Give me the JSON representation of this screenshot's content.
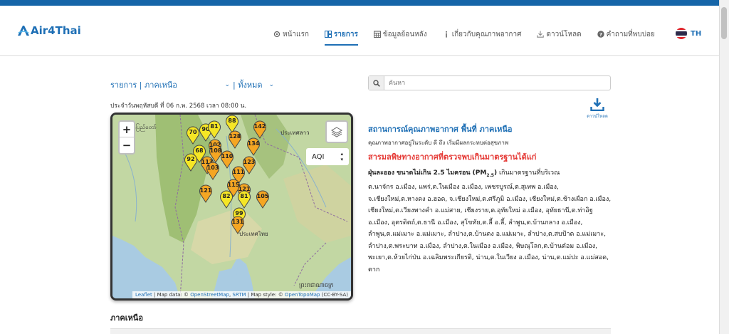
{
  "brand": {
    "name": "Air4Thai",
    "color": "#1e6fb5"
  },
  "nav": [
    {
      "label": "หน้าแรก",
      "icon": "home-icon",
      "active": false
    },
    {
      "label": "รายการ",
      "icon": "list-icon",
      "active": true
    },
    {
      "label": "ข้อมูลย้อนหลัง",
      "icon": "calendar-icon",
      "active": false
    },
    {
      "label": "เกี่ยวกับคุณภาพอากาศ",
      "icon": "info-icon",
      "active": false
    },
    {
      "label": "ดาวน์โหลด",
      "icon": "download-icon",
      "active": false
    },
    {
      "label": "คำถามที่พบบ่อย",
      "icon": "question-icon",
      "active": false
    }
  ],
  "language": {
    "code": "TH"
  },
  "filter": {
    "region": "รายการ | ภาคเหนือ",
    "scope": "| ทั้งหมด"
  },
  "date_text": "ประจำวันพฤหัสบดี ที่ 06 ก.พ. 2568 เวลา 08:00 น.",
  "map": {
    "zoom_in": "+",
    "zoom_out": "−",
    "layer_select": "AQI",
    "labels": [
      {
        "text": "နေပြည်တော်"
      },
      {
        "text": "ประเทศลาว"
      },
      {
        "text": "ประเทศไทย"
      },
      {
        "text": "ព្រះរាជាណាចក្រ"
      }
    ],
    "attribution": {
      "leaflet": "Leaflet",
      "mapdata": " | Map data: © ",
      "osm": "OpenStreetMap",
      "sep": ", ",
      "srtm": "SRTM",
      "style": " | Map style: © ",
      "otm": "OpenTopoMap",
      "license": " (CC-BY-SA)"
    },
    "markers": [
      {
        "value": "88",
        "level": "moderate"
      },
      {
        "value": "70",
        "level": "moderate"
      },
      {
        "value": "90",
        "level": "moderate"
      },
      {
        "value": "81",
        "level": "moderate"
      },
      {
        "value": "128",
        "level": "unhealthy"
      },
      {
        "value": "142",
        "level": "unhealthy"
      },
      {
        "value": "102",
        "level": "unhealthy"
      },
      {
        "value": "108",
        "level": "unhealthy"
      },
      {
        "value": "134",
        "level": "unhealthy"
      },
      {
        "value": "68",
        "level": "moderate"
      },
      {
        "value": "110",
        "level": "unhealthy"
      },
      {
        "value": "92",
        "level": "moderate"
      },
      {
        "value": "113",
        "level": "unhealthy"
      },
      {
        "value": "123",
        "level": "unhealthy"
      },
      {
        "value": "103",
        "level": "unhealthy"
      },
      {
        "value": "111",
        "level": "unhealthy"
      },
      {
        "value": "115",
        "level": "unhealthy"
      },
      {
        "value": "121",
        "level": "unhealthy"
      },
      {
        "value": "121",
        "level": "unhealthy"
      },
      {
        "value": "82",
        "level": "moderate"
      },
      {
        "value": "81",
        "level": "moderate"
      },
      {
        "value": "105",
        "level": "unhealthy"
      },
      {
        "value": "99",
        "level": "moderate"
      },
      {
        "value": "131",
        "level": "unhealthy"
      }
    ],
    "colors": {
      "moderate": "#f5e625",
      "unhealthy": "#f5a623",
      "good": "#8bd34a"
    }
  },
  "search": {
    "placeholder": "ค้นหา"
  },
  "download": {
    "label": "ดาวน์โหลด"
  },
  "info": {
    "title": "สถานการณ์คุณภาพอากาศ พื้นที่ ภาคเหนือ",
    "subtitle": "คุณภาพอากาศอยู่ในระดับ ดี ถึง เริ่มมีผลกระทบต่อสุขภาพ",
    "warning": "สารมลพิษทางอากาศที่ตรวจพบเกินมาตรฐานได้แก่",
    "pm_label_a": "ฝุ่นละออง ขนาดไม่เกิน 2.5 ไมครอน (PM",
    "pm_sub": "2.5",
    "pm_label_b": ")",
    "pm_exceed": " เกินมาตรฐานที่บริเวณ",
    "lines": [
      "ต.นาจักร อ.เมือง, แพร่,ต.ในเมือง อ.เมือง, เพชรบูรณ์,ต.สุเทพ อ.เมือง,",
      "จ.เชียงใหม่,ต.หางดง อ.ฮอด, จ.เชียงใหม่,ต.ศรีภูมิ อ.เมือง, เชียงใหม่,ต.ช้างเผือก อ.เมือง,",
      "เชียงใหม่,ต.เวียงพางคำ อ.แม่สาย, เชียงราย,ต.อุทัยใหม่ อ.เมือง, อุทัยธานี,ต.ท่าอิฐ",
      "อ.เมือง, อุตรดิตถ์,ต.ธานี อ.เมือง, สุโขทัย,ต.ลี้ อ.ลี้, ลำพูน,ต.บ้านกลาง อ.เมือง,",
      "ลำพูน,ต.แม่เมาะ อ.แม่เมาะ, ลำปาง,ต.บ้านดง อ.แม่เมาะ, ลำปาง,ต.สบป้าด อ.แม่เมาะ,",
      "ลำปาง,ต.พระบาท อ.เมือง, ลำปาง,ต.ในเมือง อ.เมือง, พิษณุโลก,ต.บ้านต๋อม อ.เมือง,",
      "พะเยา,ต.ห้วยไก่ป่น อ.เฉลิมพระเกียรติ, น่าน,ต.ในเวียง อ.เมือง, น่าน,ต.แม่ปะ อ.แม่สอด,",
      "ตาก"
    ]
  },
  "section": {
    "title": "ภาคเหนือ"
  }
}
